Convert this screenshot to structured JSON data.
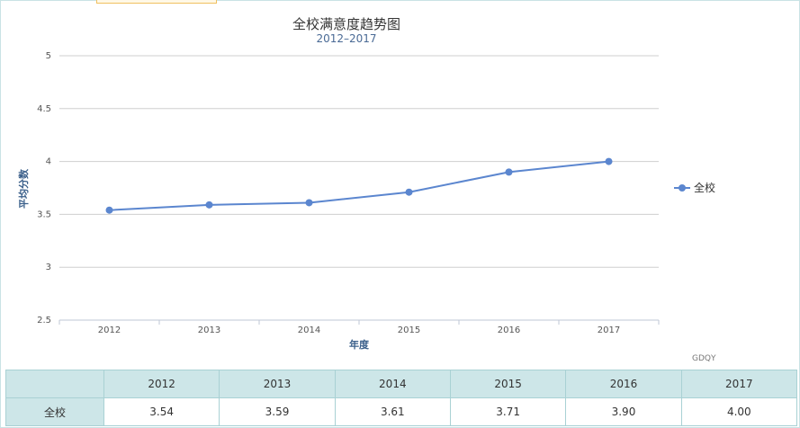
{
  "chart_data": {
    "type": "line",
    "title": "全校满意度趋势图",
    "subtitle": "2012–2017",
    "xlabel": "年度",
    "ylabel": "平均分数",
    "categories": [
      "2012",
      "2013",
      "2014",
      "2015",
      "2016",
      "2017"
    ],
    "series": [
      {
        "name": "全校",
        "values": [
          3.54,
          3.59,
          3.61,
          3.71,
          3.9,
          4.0
        ],
        "color": "#5b86cf"
      }
    ],
    "yticks": [
      "2.5",
      "3",
      "3.5",
      "4",
      "4.5",
      "5"
    ],
    "ylim": [
      2.5,
      5
    ],
    "grid": true,
    "legend": "right",
    "credit": "GDQY"
  },
  "table": {
    "headers": [
      "2012",
      "2013",
      "2014",
      "2015",
      "2016",
      "2017"
    ],
    "rows": [
      {
        "label": "全校",
        "cells": [
          "3.54",
          "3.59",
          "3.61",
          "3.71",
          "3.90",
          "4.00"
        ]
      }
    ]
  }
}
